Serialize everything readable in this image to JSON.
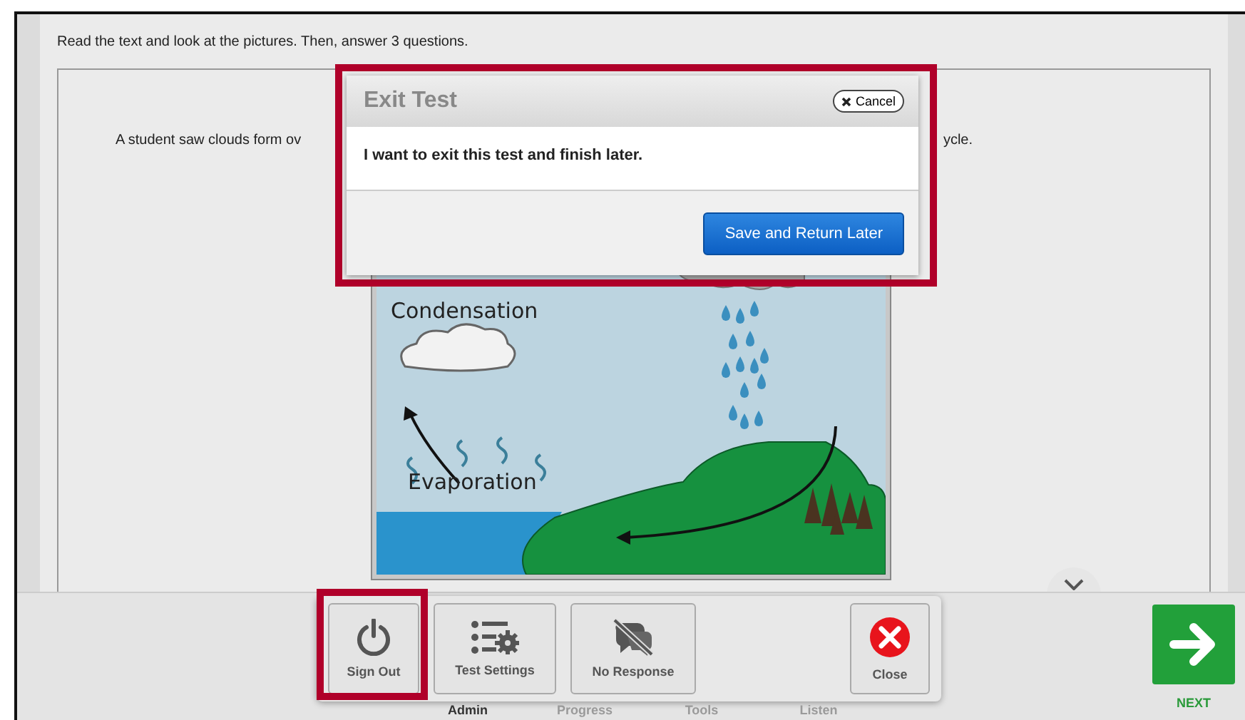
{
  "instructions": "Read the text and look at the pictures. Then, answer 3 questions.",
  "passage": {
    "sentence_start": "A student saw clouds form ov",
    "sentence_end": "ycle.",
    "diagram": {
      "labels": [
        "Condensation",
        "Evaporation"
      ]
    }
  },
  "dialog": {
    "title": "Exit Test",
    "cancel": "Cancel",
    "message": "I want to exit this test and finish later.",
    "primary_button": "Save and Return Later",
    "highlighted": true
  },
  "toolbar": {
    "buttons": [
      {
        "kind": "power",
        "label": "Sign Out",
        "highlighted": true
      },
      {
        "kind": "settings",
        "label": "Test Settings",
        "highlighted": false
      },
      {
        "kind": "no-response",
        "label": "No Response",
        "highlighted": false
      },
      {
        "kind": "close",
        "label": "Close",
        "highlighted": false
      }
    ],
    "tabs": [
      {
        "label": "Admin",
        "selected": true
      },
      {
        "label": "Progress",
        "selected": false
      },
      {
        "label": "Tools",
        "selected": false
      },
      {
        "label": "Listen",
        "selected": false
      }
    ]
  },
  "next": {
    "label": "NEXT"
  }
}
